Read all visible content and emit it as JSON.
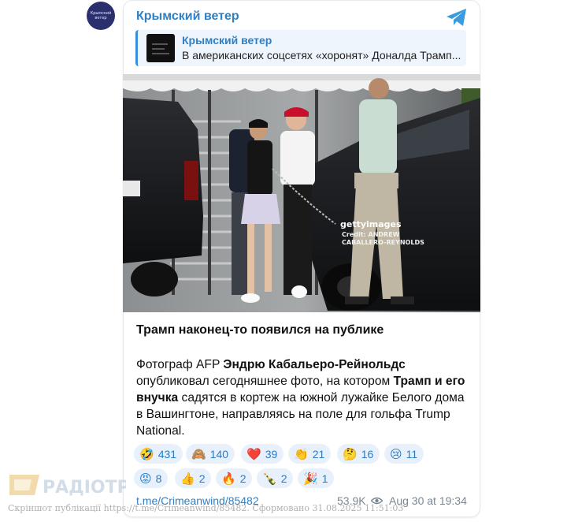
{
  "channel": {
    "name": "Крымский ветер",
    "avatar_text": "Крымский ветер"
  },
  "reply": {
    "title": "Крымский ветер",
    "text": "В американских соцсетях «хоронят» Доналда Трамп..."
  },
  "photo": {
    "watermark_logo": "gettyimages",
    "credit": "Credit: ANDREW CABALLERO-REYNOLDS"
  },
  "post": {
    "title": "Трамп наконец-то появился на публике",
    "body": [
      {
        "text": "Фотограф AFP ",
        "bold": false
      },
      {
        "text": "Эндрю Кабальеро-Рейнольдс",
        "bold": true
      },
      {
        "text": " опубликовал сегодняшнее фото, на котором ",
        "bold": false
      },
      {
        "text": "Трамп и его внучка",
        "bold": true
      },
      {
        "text": " садятся в кортеж на южной лужайке Белого дома в Вашингтоне, направляясь на поле для гольфа Trump National.",
        "bold": false
      }
    ]
  },
  "reactions": [
    {
      "emoji": "🤣",
      "count": "431"
    },
    {
      "emoji": "🙈",
      "count": "140"
    },
    {
      "emoji": "❤️",
      "count": "39"
    },
    {
      "emoji": "👏",
      "count": "21"
    },
    {
      "emoji": "🤔",
      "count": "16"
    },
    {
      "emoji": "😢",
      "count": "11"
    },
    {
      "emoji": "😡",
      "count": "8"
    },
    {
      "emoji": "👍",
      "count": "2"
    },
    {
      "emoji": "🔥",
      "count": "2"
    },
    {
      "emoji": "🍾",
      "count": "2"
    },
    {
      "emoji": "🎉",
      "count": "1"
    }
  ],
  "footer": {
    "link": "t.me/Crimeanwind/85482",
    "views": "53.9K",
    "date": "Aug 30 at 19:34"
  },
  "watermark": {
    "logo": "РАДІОТРЕК",
    "caption": "Скріншот публікації https://t.me/Crimeanwind/85482. Сформовано 31.08.2025 11:51:03"
  },
  "colors": {
    "accent": "#2f7fc4",
    "reaction_bg": "#e8f1fb",
    "muted": "#7a8793"
  }
}
